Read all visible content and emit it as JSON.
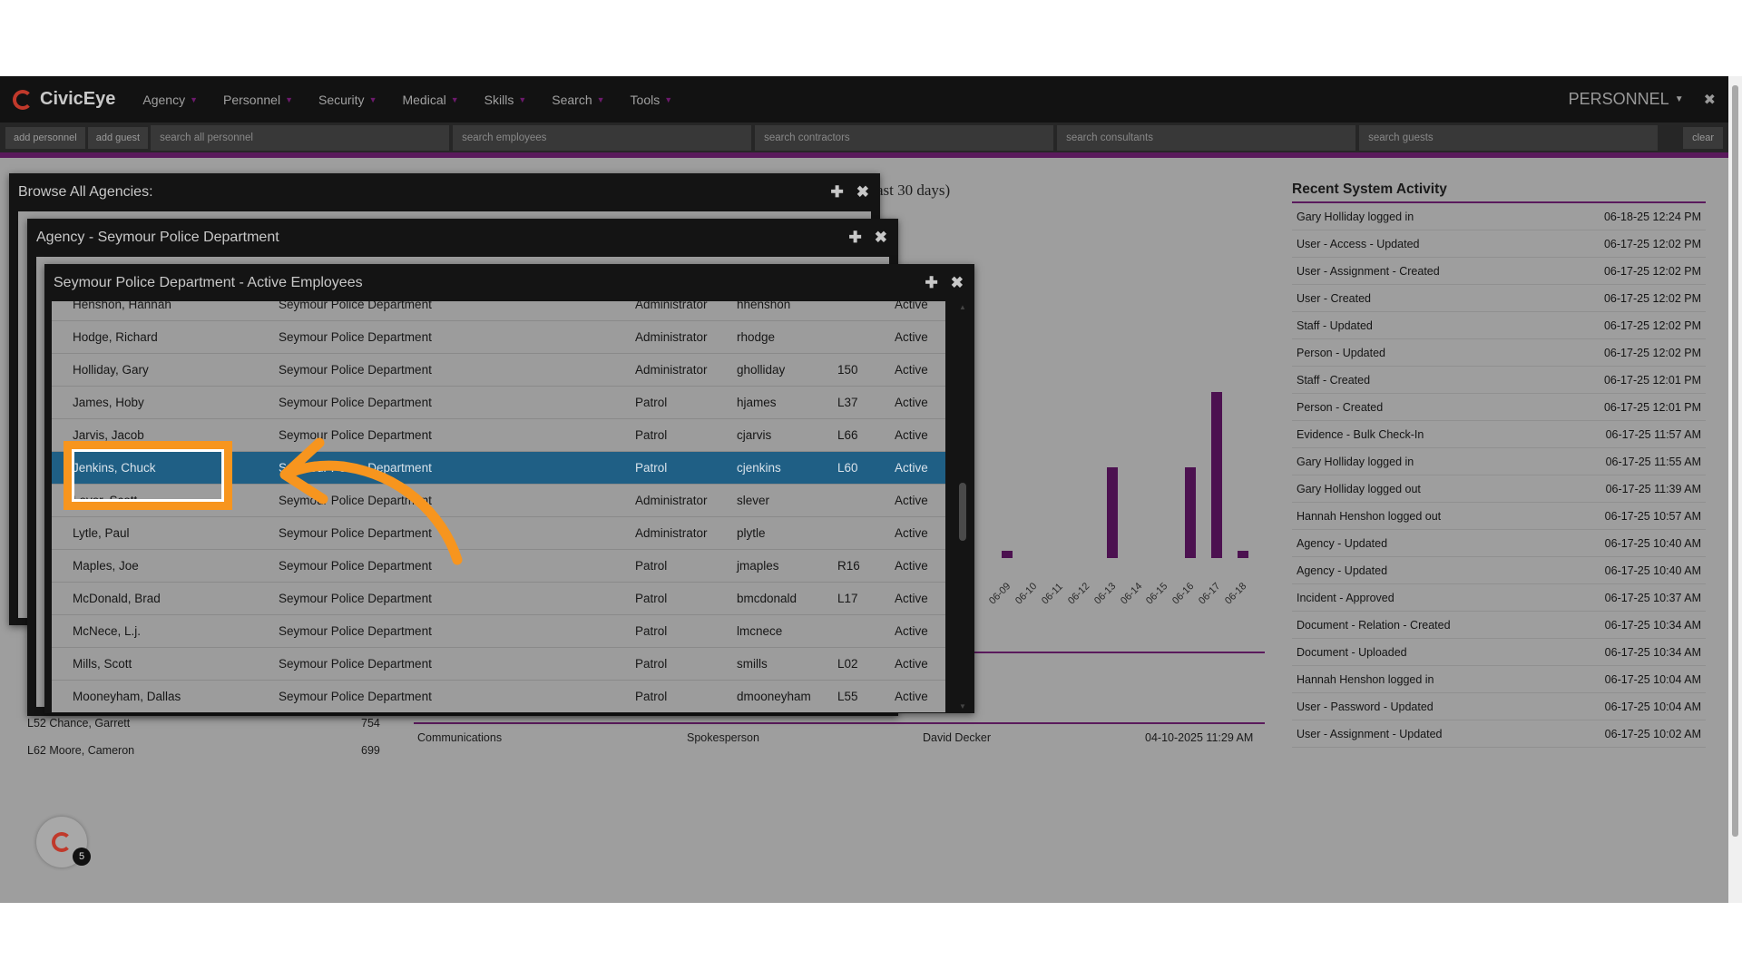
{
  "app": {
    "name": "CivicEye"
  },
  "nav": {
    "items": [
      "Agency",
      "Personnel",
      "Security",
      "Medical",
      "Skills",
      "Search",
      "Tools"
    ],
    "module": "PERSONNEL"
  },
  "toolbar": {
    "add_personnel": "add personnel",
    "add_guest": "add guest",
    "search_all": "search all personnel",
    "search_employees": "search employees",
    "search_contractors": "search contractors",
    "search_consultants": "search consultants",
    "search_guests": "search guests",
    "clear": "clear"
  },
  "background": {
    "chart_title_partial": "ast 30 days)",
    "ticks": [
      "06-09",
      "06-10",
      "06-11",
      "06-12",
      "06-13",
      "06-14",
      "06-15",
      "06-16",
      "06-17",
      "06-18"
    ],
    "list": [
      {
        "name": "L52 Chance, Garrett",
        "value": "754"
      },
      {
        "name": "L62 Moore, Cameron",
        "value": "699"
      }
    ],
    "record": {
      "dept": "Communications",
      "role": "Spokesperson",
      "person": "David Decker",
      "date": "04-10-2025 11:29 AM"
    }
  },
  "chart_data": {
    "type": "bar",
    "categories": [
      "06-09",
      "06-10",
      "06-11",
      "06-12",
      "06-13",
      "06-14",
      "06-15",
      "06-16",
      "06-17",
      "06-18"
    ],
    "values": [
      0.5,
      0,
      0,
      0,
      6,
      0,
      0,
      6,
      11,
      0.5
    ],
    "title": "",
    "xlabel": "",
    "ylabel": ""
  },
  "activity": {
    "title": "Recent System Activity",
    "rows": [
      {
        "label": "Gary Holliday logged in",
        "time": "06-18-25 12:24 PM"
      },
      {
        "label": "User - Access - Updated",
        "time": "06-17-25 12:02 PM"
      },
      {
        "label": "User - Assignment - Created",
        "time": "06-17-25 12:02 PM"
      },
      {
        "label": "User - Created",
        "time": "06-17-25 12:02 PM"
      },
      {
        "label": "Staff - Updated",
        "time": "06-17-25 12:02 PM"
      },
      {
        "label": "Person - Updated",
        "time": "06-17-25 12:02 PM"
      },
      {
        "label": "Staff - Created",
        "time": "06-17-25 12:01 PM"
      },
      {
        "label": "Person - Created",
        "time": "06-17-25 12:01 PM"
      },
      {
        "label": "Evidence - Bulk Check-In",
        "time": "06-17-25 11:57 AM"
      },
      {
        "label": "Gary Holliday logged in",
        "time": "06-17-25 11:55 AM"
      },
      {
        "label": "Gary Holliday logged out",
        "time": "06-17-25 11:39 AM"
      },
      {
        "label": "Hannah Henshon logged out",
        "time": "06-17-25 10:57 AM"
      },
      {
        "label": "Agency - Updated",
        "time": "06-17-25 10:40 AM"
      },
      {
        "label": "Agency - Updated",
        "time": "06-17-25 10:40 AM"
      },
      {
        "label": "Incident - Approved",
        "time": "06-17-25 10:37 AM"
      },
      {
        "label": "Document - Relation - Created",
        "time": "06-17-25 10:34 AM"
      },
      {
        "label": "Document - Uploaded",
        "time": "06-17-25 10:34 AM"
      },
      {
        "label": "Hannah Henshon logged in",
        "time": "06-17-25 10:04 AM"
      },
      {
        "label": "User - Password - Updated",
        "time": "06-17-25 10:04 AM"
      },
      {
        "label": "User - Assignment - Updated",
        "time": "06-17-25 10:02 AM"
      }
    ]
  },
  "windows": {
    "browse": {
      "title": "Browse All Agencies:"
    },
    "agency": {
      "title": "Agency - Seymour Police Department"
    },
    "employees": {
      "title": "Seymour Police Department - Active Employees"
    }
  },
  "employees": [
    {
      "name": "Henshon, Hannah",
      "dept": "Seymour Police Department",
      "role": "Administrator",
      "user": "hhenshon",
      "unit": "",
      "status": "Active"
    },
    {
      "name": "Hodge, Richard",
      "dept": "Seymour Police Department",
      "role": "Administrator",
      "user": "rhodge",
      "unit": "",
      "status": "Active"
    },
    {
      "name": "Holliday, Gary",
      "dept": "Seymour Police Department",
      "role": "Administrator",
      "user": "gholliday",
      "unit": "150",
      "status": "Active"
    },
    {
      "name": "James, Hoby",
      "dept": "Seymour Police Department",
      "role": "Patrol",
      "user": "hjames",
      "unit": "L37",
      "status": "Active"
    },
    {
      "name": "Jarvis, Jacob",
      "dept": "Seymour Police Department",
      "role": "Patrol",
      "user": "cjarvis",
      "unit": "L66",
      "status": "Active"
    },
    {
      "name": "Jenkins, Chuck",
      "dept": "Seymour Police Department",
      "role": "Patrol",
      "user": "cjenkins",
      "unit": "L60",
      "status": "Active"
    },
    {
      "name": "Lever, Scott",
      "dept": "Seymour Police Department",
      "role": "Administrator",
      "user": "slever",
      "unit": "",
      "status": "Active"
    },
    {
      "name": "Lytle, Paul",
      "dept": "Seymour Police Department",
      "role": "Administrator",
      "user": "plytle",
      "unit": "",
      "status": "Active"
    },
    {
      "name": "Maples, Joe",
      "dept": "Seymour Police Department",
      "role": "Patrol",
      "user": "jmaples",
      "unit": "R16",
      "status": "Active"
    },
    {
      "name": "McDonald, Brad",
      "dept": "Seymour Police Department",
      "role": "Patrol",
      "user": "bmcdonald",
      "unit": "L17",
      "status": "Active"
    },
    {
      "name": "McNece, L.j.",
      "dept": "Seymour Police Department",
      "role": "Patrol",
      "user": "lmcnece",
      "unit": "",
      "status": "Active"
    },
    {
      "name": "Mills, Scott",
      "dept": "Seymour Police Department",
      "role": "Patrol",
      "user": "smills",
      "unit": "L02",
      "status": "Active"
    },
    {
      "name": "Mooneyham, Dallas",
      "dept": "Seymour Police Department",
      "role": "Patrol",
      "user": "dmooneyham",
      "unit": "L55",
      "status": "Active"
    }
  ],
  "selected_index": 5,
  "float": {
    "badge": "5"
  }
}
